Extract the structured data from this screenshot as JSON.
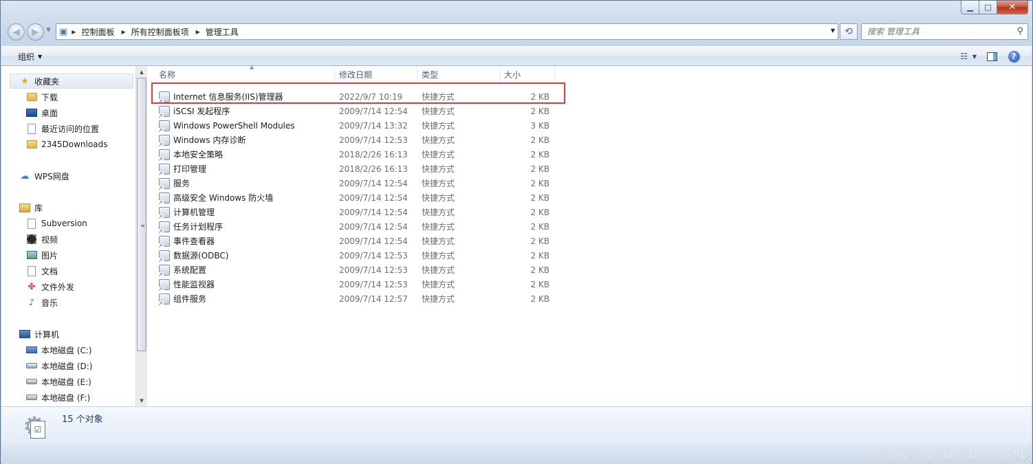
{
  "window": {
    "min_label": "▁",
    "max_label": "□",
    "close_label": "✕"
  },
  "address": {
    "breadcrumbs": [
      "控制面板",
      "所有控制面板项",
      "管理工具"
    ],
    "search_placeholder": "搜索 管理工具"
  },
  "toolbar": {
    "organize_label": "组织"
  },
  "sidebar": {
    "favorites": {
      "label": "收藏夹",
      "items": [
        "下载",
        "桌面",
        "最近访问的位置",
        "2345Downloads"
      ]
    },
    "wps": {
      "label": "WPS网盘"
    },
    "libraries": {
      "label": "库",
      "items": [
        "Subversion",
        "视频",
        "图片",
        "文档",
        "文件外发",
        "音乐"
      ]
    },
    "computer": {
      "label": "计算机",
      "items": [
        "本地磁盘 (C:)",
        "本地磁盘 (D:)",
        "本地磁盘 (E:)",
        "本地磁盘 (F:)"
      ]
    }
  },
  "columns": {
    "name": "名称",
    "date": "修改日期",
    "type": "类型",
    "size": "大小"
  },
  "files": [
    {
      "name": "Internet 信息服务(IIS)管理器",
      "date": "2022/9/7 10:19",
      "type": "快捷方式",
      "size": "2 KB"
    },
    {
      "name": "iSCSI 发起程序",
      "date": "2009/7/14 12:54",
      "type": "快捷方式",
      "size": "2 KB"
    },
    {
      "name": "Windows PowerShell Modules",
      "date": "2009/7/14 13:32",
      "type": "快捷方式",
      "size": "3 KB"
    },
    {
      "name": "Windows 内存诊断",
      "date": "2009/7/14 12:53",
      "type": "快捷方式",
      "size": "2 KB"
    },
    {
      "name": "本地安全策略",
      "date": "2018/2/26 16:13",
      "type": "快捷方式",
      "size": "2 KB"
    },
    {
      "name": "打印管理",
      "date": "2018/2/26 16:13",
      "type": "快捷方式",
      "size": "2 KB"
    },
    {
      "name": "服务",
      "date": "2009/7/14 12:54",
      "type": "快捷方式",
      "size": "2 KB"
    },
    {
      "name": "高级安全 Windows 防火墙",
      "date": "2009/7/14 12:54",
      "type": "快捷方式",
      "size": "2 KB"
    },
    {
      "name": "计算机管理",
      "date": "2009/7/14 12:54",
      "type": "快捷方式",
      "size": "2 KB"
    },
    {
      "name": "任务计划程序",
      "date": "2009/7/14 12:54",
      "type": "快捷方式",
      "size": "2 KB"
    },
    {
      "name": "事件查看器",
      "date": "2009/7/14 12:54",
      "type": "快捷方式",
      "size": "2 KB"
    },
    {
      "name": "数据源(ODBC)",
      "date": "2009/7/14 12:53",
      "type": "快捷方式",
      "size": "2 KB"
    },
    {
      "name": "系统配置",
      "date": "2009/7/14 12:53",
      "type": "快捷方式",
      "size": "2 KB"
    },
    {
      "name": "性能监视器",
      "date": "2009/7/14 12:53",
      "type": "快捷方式",
      "size": "2 KB"
    },
    {
      "name": "组件服务",
      "date": "2009/7/14 12:57",
      "type": "快捷方式",
      "size": "2 KB"
    }
  ],
  "details": {
    "count_text": "15 个对象"
  },
  "watermark": "CSDN @weixin_45003524",
  "colors": {
    "highlight_border": "#e23a3a",
    "frame": "#c6d7ea"
  }
}
